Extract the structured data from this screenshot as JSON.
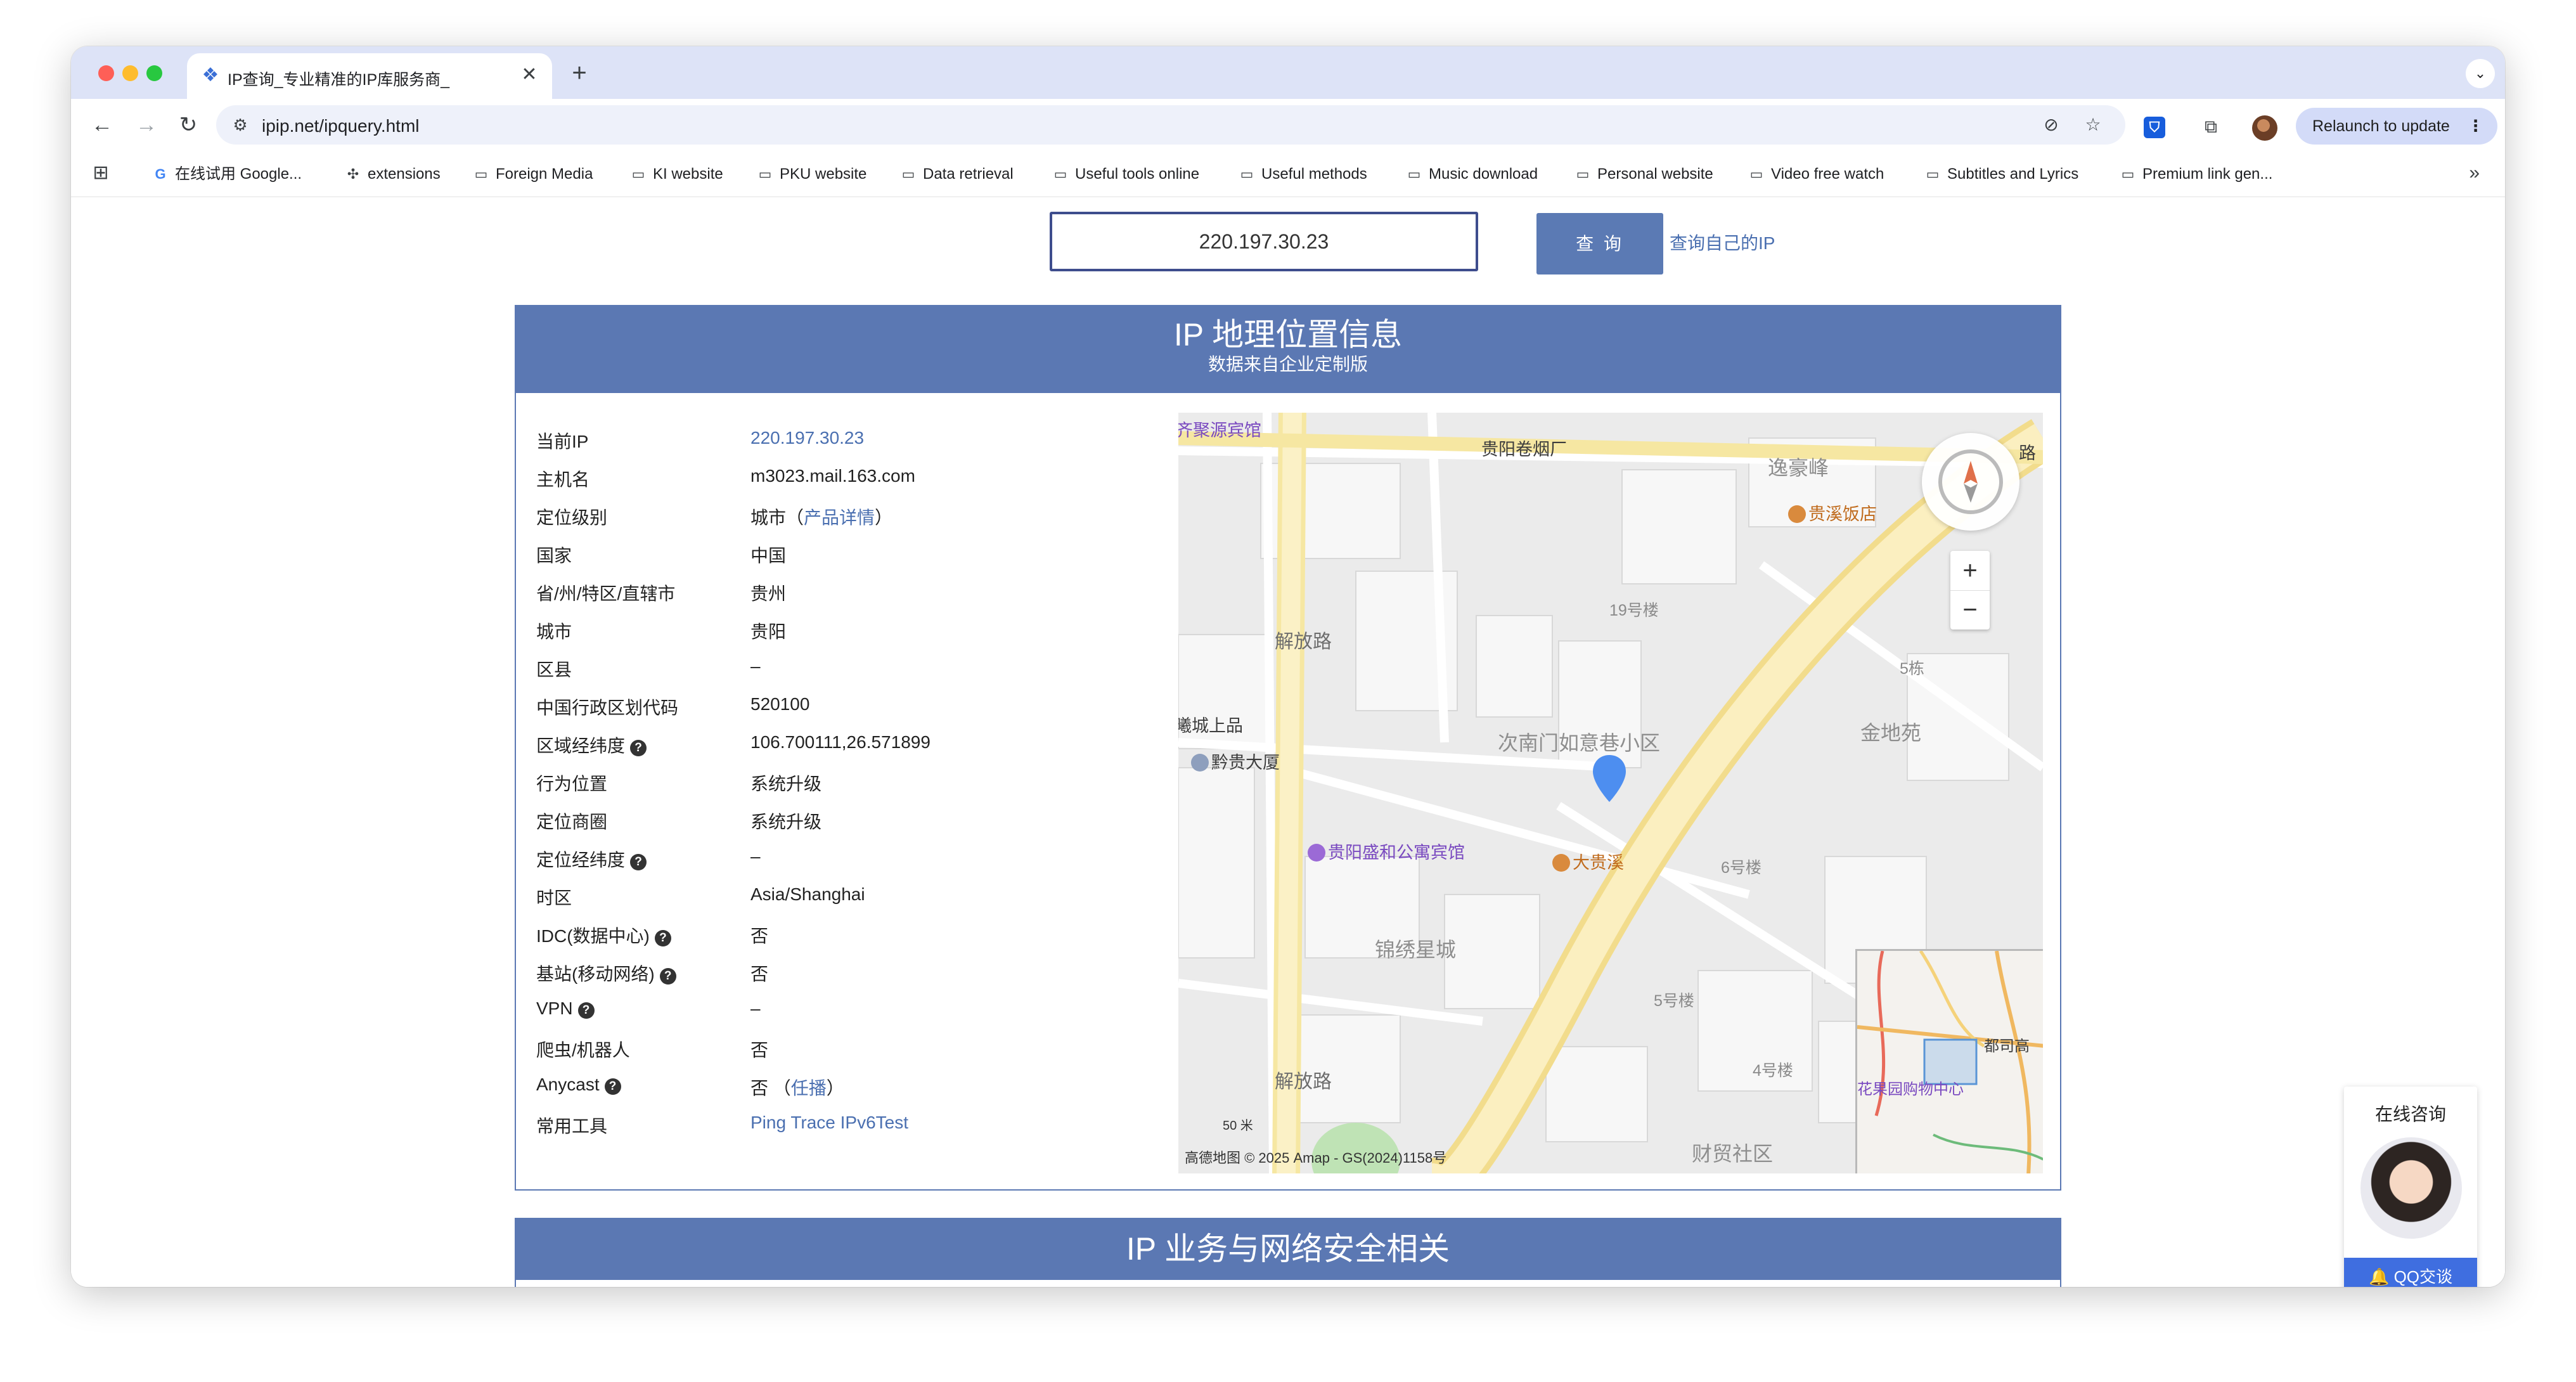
{
  "browser": {
    "tab_title": "IP查询_专业精准的IP库服务商_",
    "tab_close": "✕",
    "new_tab": "+",
    "url": "ipip.net/ipquery.html",
    "relaunch_label": "Relaunch to update",
    "bookmarks": [
      {
        "label": "在线试用 Google...",
        "icon": "google-icon"
      },
      {
        "label": "extensions",
        "icon": "puzzle-icon"
      },
      {
        "label": "Foreign Media",
        "icon": "folder-icon"
      },
      {
        "label": "KI website",
        "icon": "folder-icon"
      },
      {
        "label": "PKU website",
        "icon": "folder-icon"
      },
      {
        "label": "Data retrieval",
        "icon": "folder-icon"
      },
      {
        "label": "Useful tools online",
        "icon": "folder-icon"
      },
      {
        "label": "Useful methods",
        "icon": "folder-icon"
      },
      {
        "label": "Music download",
        "icon": "folder-icon"
      },
      {
        "label": "Personal website",
        "icon": "folder-icon"
      },
      {
        "label": "Video free watch",
        "icon": "folder-icon"
      },
      {
        "label": "Subtitles and Lyrics",
        "icon": "folder-icon"
      },
      {
        "label": "Premium link gen...",
        "icon": "folder-icon"
      }
    ],
    "more": "»"
  },
  "search": {
    "value": "220.197.30.23",
    "button_label": "查 询",
    "my_ip_link": "查询自己的IP"
  },
  "geo_panel": {
    "title": "IP 地理位置信息",
    "subtitle": "数据来自企业定制版",
    "rows": [
      {
        "label": "当前IP",
        "value": "220.197.30.23",
        "link": true
      },
      {
        "label": "主机名",
        "value": "m3023.mail.163.com"
      },
      {
        "label": "定位级别",
        "value": "城市（",
        "value_link": "产品详情",
        "value_suffix": "）"
      },
      {
        "label": "国家",
        "value": "中国"
      },
      {
        "label": "省/州/特区/直辖市",
        "value": "贵州"
      },
      {
        "label": "城市",
        "value": "贵阳"
      },
      {
        "label": "区县",
        "value": "–"
      },
      {
        "label": "中国行政区划代码",
        "value": "520100"
      },
      {
        "label": "区域经纬度",
        "help": true,
        "value": "106.700111,26.571899"
      },
      {
        "label": "行为位置",
        "value": "系统升级"
      },
      {
        "label": "定位商圈",
        "value": "系统升级"
      },
      {
        "label": "定位经纬度",
        "help": true,
        "value": "–"
      },
      {
        "label": "时区",
        "value": "Asia/Shanghai"
      },
      {
        "label": "IDC(数据中心)",
        "help": true,
        "value": "否"
      },
      {
        "label": "基站(移动网络)",
        "help": true,
        "value": "否"
      },
      {
        "label": "VPN",
        "help": true,
        "value": "–"
      },
      {
        "label": "爬虫/机器人",
        "value": "否"
      },
      {
        "label": "Anycast",
        "help": true,
        "value": "否 （",
        "value_link": "任播",
        "value_suffix": "）"
      },
      {
        "label": "常用工具",
        "value": "",
        "value_link": "Ping Trace IPv6Test"
      }
    ],
    "help_glyph": "?"
  },
  "map": {
    "labels": {
      "hotel1": "齐聚源宾馆",
      "factory": "贵阳卷烟厂",
      "yihao": "逸豪峰",
      "guixi": "贵溪饭店",
      "bld19": "19号楼",
      "bld5d": "5栋",
      "jindi": "金地苑",
      "xicheng": "曦城上品",
      "qiangui": "黔贵大厦",
      "cinanmen": "次南门如意巷小区",
      "shenghe": "贵阳盛和公寓宾馆",
      "daguixi": "大贵溪",
      "bld6": "6号楼",
      "jinxiu": "锦绣星城",
      "bld5": "5号楼",
      "bld4": "4号楼",
      "caimao": "财贸社区",
      "dusi": "都司高",
      "huaguo": "花果园购物中心",
      "road_jiefang1": "解放路",
      "road_jiefang2": "解放路",
      "road_top": "路",
      "scale": "50 米",
      "copyright": "高德地图  © 2025 Amap - GS(2024)1158号"
    },
    "zoom_in": "+",
    "zoom_out": "−"
  },
  "security_panel": {
    "title": "IP 业务与网络安全相关"
  },
  "chat": {
    "title": "在线咨询",
    "button": "QQ交谈"
  }
}
